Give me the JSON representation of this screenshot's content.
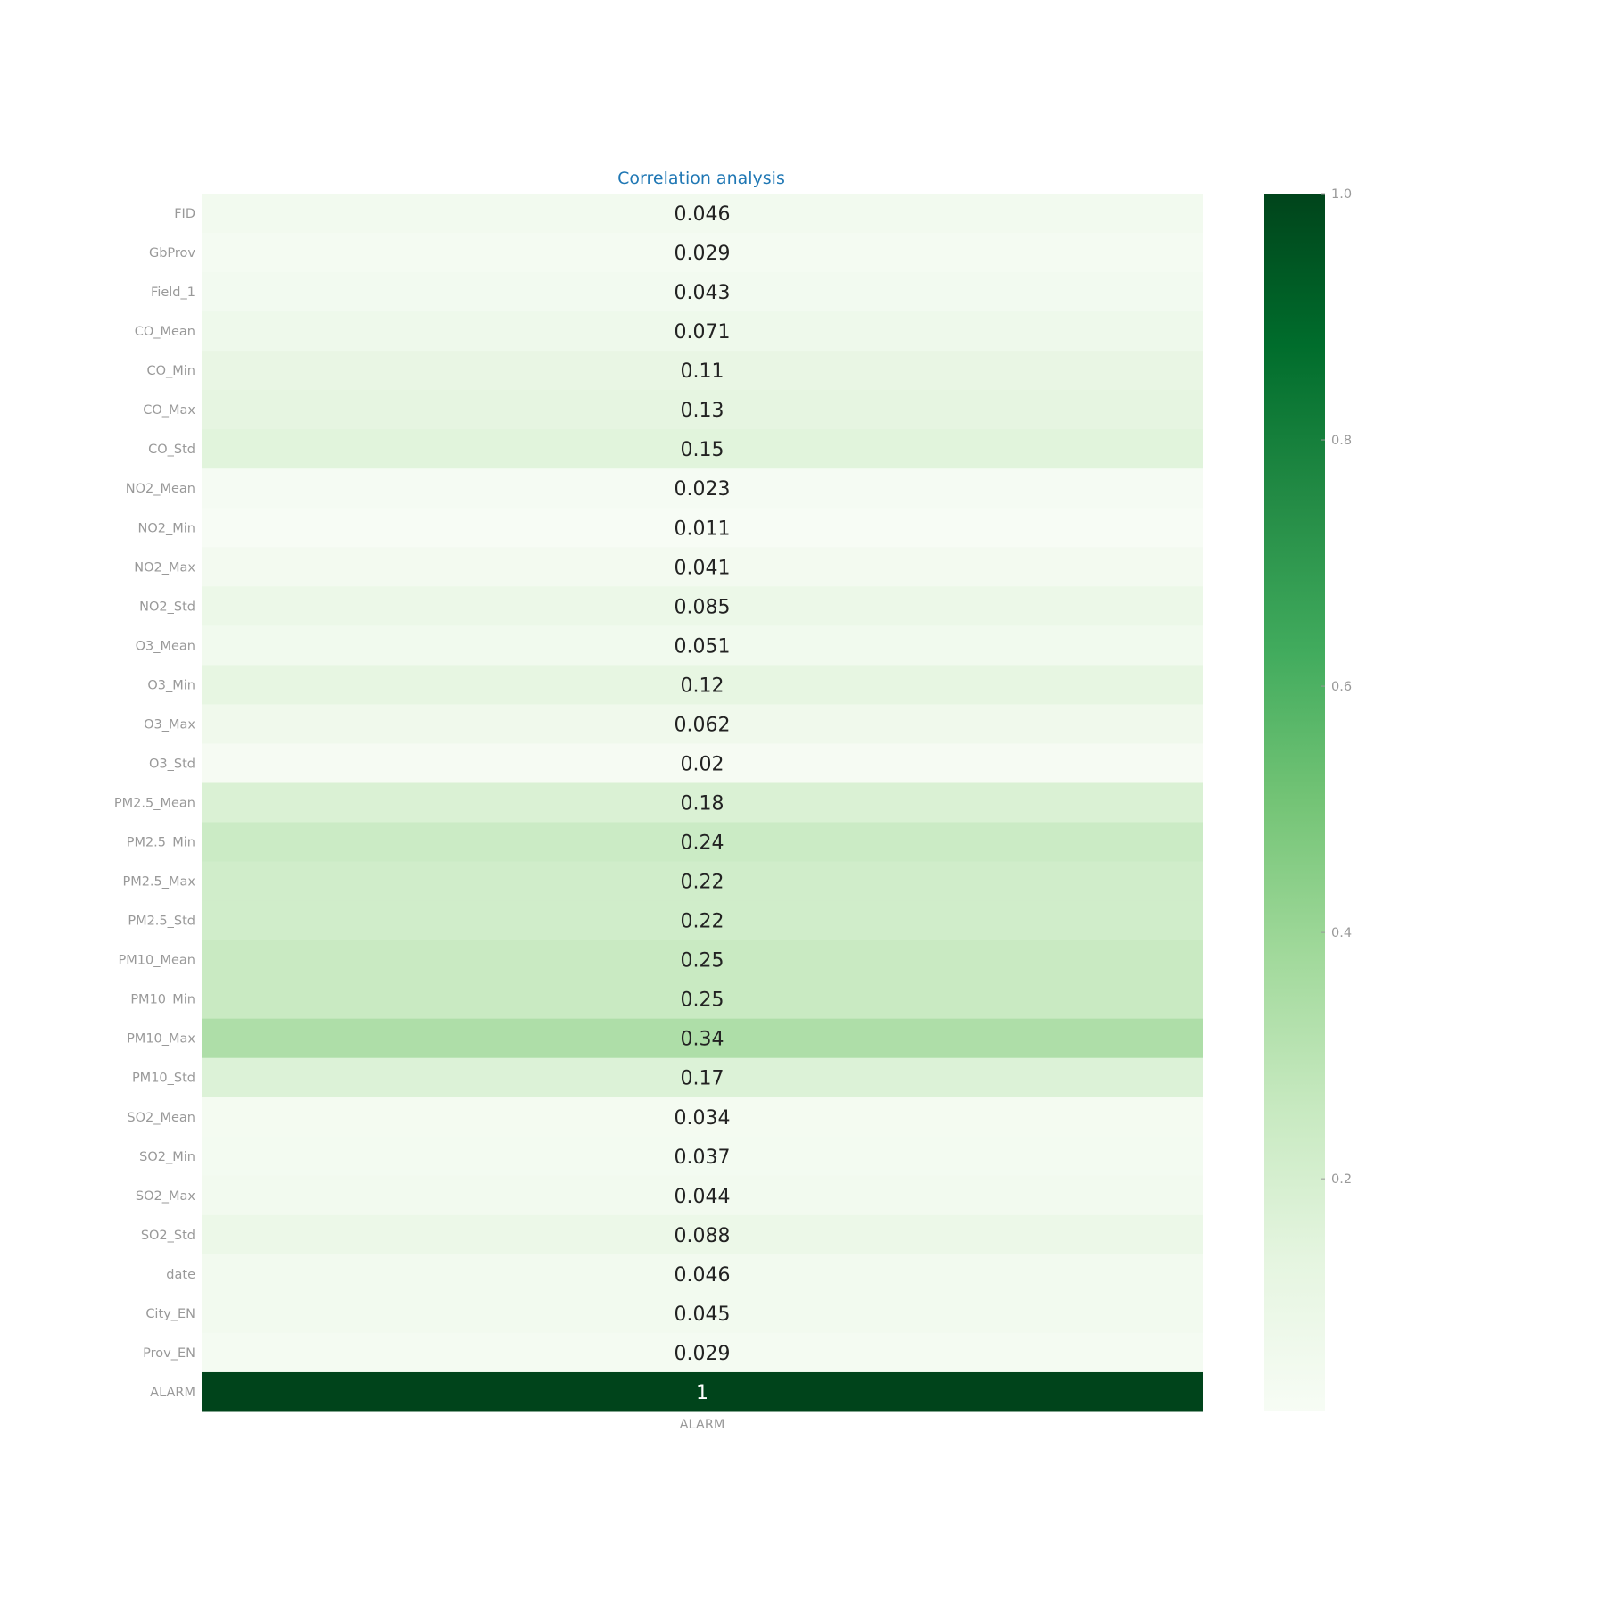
{
  "chart_data": {
    "type": "heatmap",
    "title": "Correlation analysis",
    "x_categories": [
      "ALARM"
    ],
    "y_categories": [
      "FID",
      "GbProv",
      "Field_1",
      "CO_Mean",
      "CO_Min",
      "CO_Max",
      "CO_Std",
      "NO2_Mean",
      "NO2_Min",
      "NO2_Max",
      "NO2_Std",
      "O3_Mean",
      "O3_Min",
      "O3_Max",
      "O3_Std",
      "PM2.5_Mean",
      "PM2.5_Min",
      "PM2.5_Max",
      "PM2.5_Std",
      "PM10_Mean",
      "PM10_Min",
      "PM10_Max",
      "PM10_Std",
      "SO2_Mean",
      "SO2_Min",
      "SO2_Max",
      "SO2_Std",
      "date",
      "City_EN",
      "Prov_EN",
      "ALARM"
    ],
    "values": [
      0.046,
      0.029,
      0.043,
      0.071,
      0.11,
      0.13,
      0.15,
      0.023,
      0.011,
      0.041,
      0.085,
      0.051,
      0.12,
      0.062,
      0.02,
      0.18,
      0.24,
      0.22,
      0.22,
      0.25,
      0.25,
      0.34,
      0.17,
      0.034,
      0.037,
      0.044,
      0.088,
      0.046,
      0.045,
      0.029,
      1
    ],
    "labels": [
      "0.046",
      "0.029",
      "0.043",
      "0.071",
      "0.11",
      "0.13",
      "0.15",
      "0.023",
      "0.011",
      "0.041",
      "0.085",
      "0.051",
      "0.12",
      "0.062",
      "0.02",
      "0.18",
      "0.24",
      "0.22",
      "0.22",
      "0.25",
      "0.25",
      "0.34",
      "0.17",
      "0.034",
      "0.037",
      "0.044",
      "0.088",
      "0.046",
      "0.045",
      "0.029",
      "1"
    ],
    "colorscale": "Greens",
    "colorbar": {
      "range": [
        0.011,
        1
      ],
      "tick_labels": [
        "1.0",
        "0.8",
        "0.6",
        "0.4",
        "0.2"
      ],
      "tick_values": [
        1.0,
        0.8,
        0.6,
        0.4,
        0.2
      ]
    },
    "colors": {
      "title": "#1f77b4",
      "axis_text": "#999999",
      "cell_text_dark": "#222222",
      "cell_text_light": "#ffffff"
    }
  }
}
